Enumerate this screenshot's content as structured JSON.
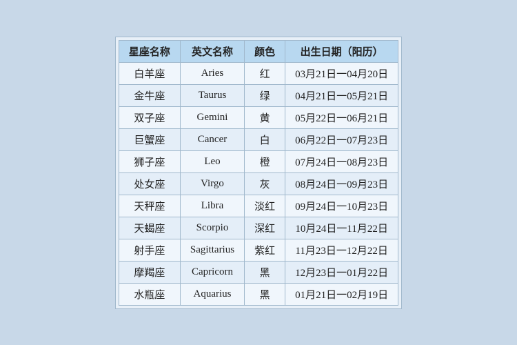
{
  "table": {
    "headers": [
      "星座名称",
      "英文名称",
      "颜色",
      "出生日期（阳历）"
    ],
    "rows": [
      [
        "白羊座",
        "Aries",
        "红",
        "03月21日一04月20日"
      ],
      [
        "金牛座",
        "Taurus",
        "绿",
        "04月21日一05月21日"
      ],
      [
        "双子座",
        "Gemini",
        "黄",
        "05月22日一06月21日"
      ],
      [
        "巨蟹座",
        "Cancer",
        "白",
        "06月22日一07月23日"
      ],
      [
        "狮子座",
        "Leo",
        "橙",
        "07月24日一08月23日"
      ],
      [
        "处女座",
        "Virgo",
        "灰",
        "08月24日一09月23日"
      ],
      [
        "天秤座",
        "Libra",
        "淡红",
        "09月24日一10月23日"
      ],
      [
        "天蝎座",
        "Scorpio",
        "深红",
        "10月24日一11月22日"
      ],
      [
        "射手座",
        "Sagittarius",
        "紫红",
        "11月23日一12月22日"
      ],
      [
        "摩羯座",
        "Capricorn",
        "黑",
        "12月23日一01月22日"
      ],
      [
        "水瓶座",
        "Aquarius",
        "黑",
        "01月21日一02月19日"
      ]
    ]
  }
}
